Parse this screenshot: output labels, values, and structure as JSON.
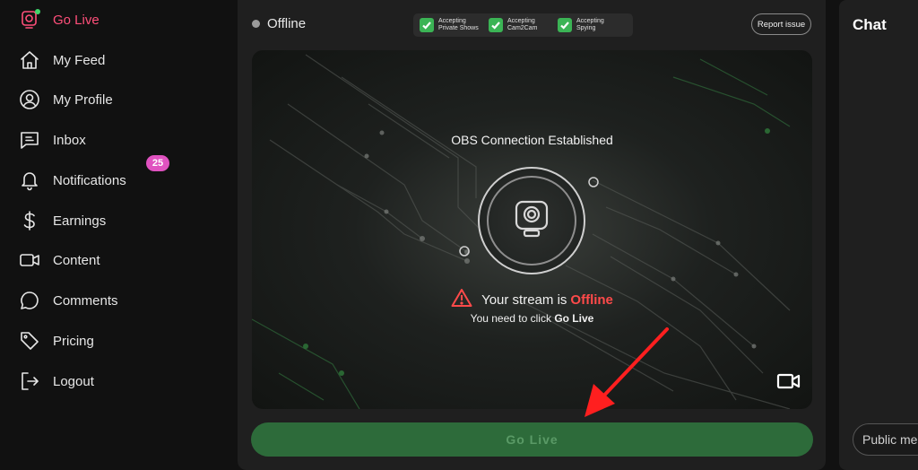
{
  "sidebar": {
    "items": [
      {
        "label": "Go Live",
        "icon": "go-live-icon"
      },
      {
        "label": "My Feed",
        "icon": "home-icon"
      },
      {
        "label": "My Profile",
        "icon": "user-icon"
      },
      {
        "label": "Inbox",
        "icon": "message-icon"
      },
      {
        "label": "Notifications",
        "icon": "bell-icon",
        "badge": "25"
      },
      {
        "label": "Earnings",
        "icon": "dollar-icon"
      },
      {
        "label": "Content",
        "icon": "video-icon"
      },
      {
        "label": "Comments",
        "icon": "comment-icon"
      },
      {
        "label": "Pricing",
        "icon": "tag-icon"
      },
      {
        "label": "Logout",
        "icon": "logout-icon"
      }
    ]
  },
  "stream": {
    "status": "Offline",
    "accepting": [
      {
        "label": "Accepting\nPrivate Shows",
        "checked": true
      },
      {
        "label": "Accepting\nCam2Cam",
        "checked": true
      },
      {
        "label": "Accepting\nSpying",
        "checked": true
      }
    ],
    "report_label": "Report issue",
    "connection_text": "OBS Connection Established",
    "stream_prefix": "Your stream is",
    "stream_state": "Offline",
    "hint_prefix": "You need to click",
    "hint_action": "Go Live",
    "go_live_button": "Go Live"
  },
  "chat": {
    "title": "Chat",
    "input_placeholder": "Public me"
  },
  "colors": {
    "accent": "#ff4f7a",
    "check": "#3bb455",
    "offline": "#ff4a4a",
    "go_live_button": "#2d6b3a",
    "badge": "#e052c0",
    "annotation_arrow": "#ff1f1f"
  }
}
